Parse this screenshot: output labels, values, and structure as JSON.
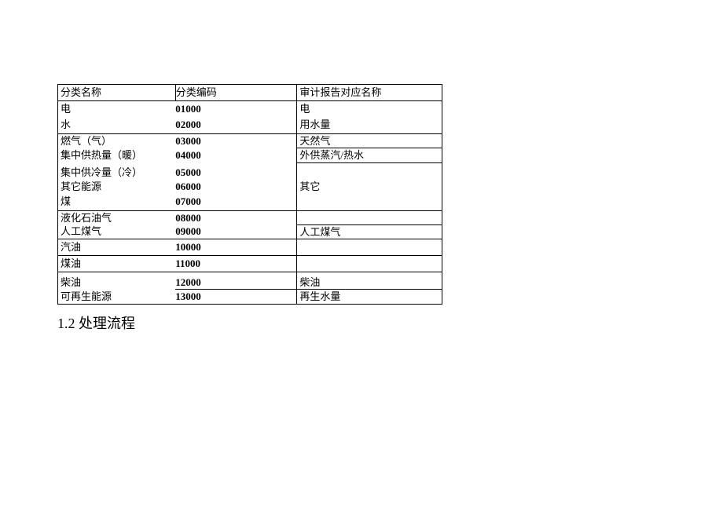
{
  "table": {
    "headers": {
      "col1": "分类名称",
      "col2": "分类编码",
      "col3": "审计报告对应名称"
    },
    "rows": {
      "r1": {
        "name": "电",
        "code": "01000",
        "audit": "电"
      },
      "r2": {
        "name": "水",
        "code": "02000",
        "audit": "用水量"
      },
      "r3": {
        "name": "燃气（气）",
        "code": "03000",
        "audit": "天然气"
      },
      "r4": {
        "name": "集中供热量（暖）",
        "code": "04000",
        "audit": "外供蒸汽/热水"
      },
      "r5": {
        "name": "集中供冷量（冷）",
        "code": "05000",
        "audit": ""
      },
      "r6": {
        "name": "其它能源",
        "code": "06000",
        "audit": "其它"
      },
      "r7": {
        "name": "煤",
        "code": "07000",
        "audit": ""
      },
      "r8": {
        "name": "液化石油气",
        "code": "08000",
        "audit": ""
      },
      "r9": {
        "name": "人工煤气",
        "code": "09000",
        "audit": "人工煤气"
      },
      "r10": {
        "name": "汽油",
        "code": "10000",
        "audit": ""
      },
      "r11": {
        "name": "煤油",
        "code": "11000",
        "audit": ""
      },
      "r12": {
        "name": "柴油",
        "code": "12000",
        "audit": "柴油"
      },
      "r13": {
        "name": "可再生能源",
        "code": "13000",
        "audit": "再生水量"
      }
    }
  },
  "section_heading": "1.2 处理流程"
}
